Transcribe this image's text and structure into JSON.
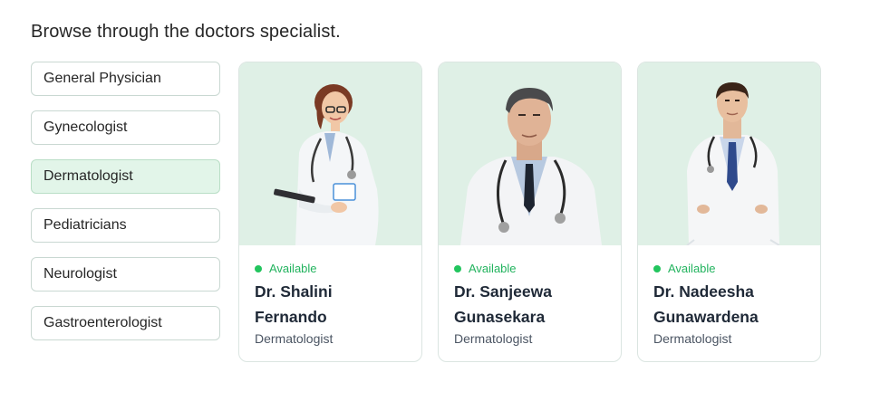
{
  "page": {
    "heading": "Browse through the doctors specialist."
  },
  "filters": [
    {
      "label": "General Physician",
      "active": false
    },
    {
      "label": "Gynecologist",
      "active": false
    },
    {
      "label": "Dermatologist",
      "active": true
    },
    {
      "label": "Pediatricians",
      "active": false
    },
    {
      "label": "Neurologist",
      "active": false
    },
    {
      "label": "Gastroenterologist",
      "active": false
    }
  ],
  "doctors": [
    {
      "status": "Available",
      "name": "Dr. Shalini Fernando",
      "specialty": "Dermatologist"
    },
    {
      "status": "Available",
      "name": "Dr. Sanjeewa Gunasekara",
      "specialty": "Dermatologist"
    },
    {
      "status": "Available",
      "name": "Dr. Nadeesha Gunawardena",
      "specialty": "Dermatologist"
    }
  ],
  "colors": {
    "accent_green": "#22c55e",
    "photo_bg": "#dff0e6",
    "active_filter_bg": "#e2f5e9"
  }
}
